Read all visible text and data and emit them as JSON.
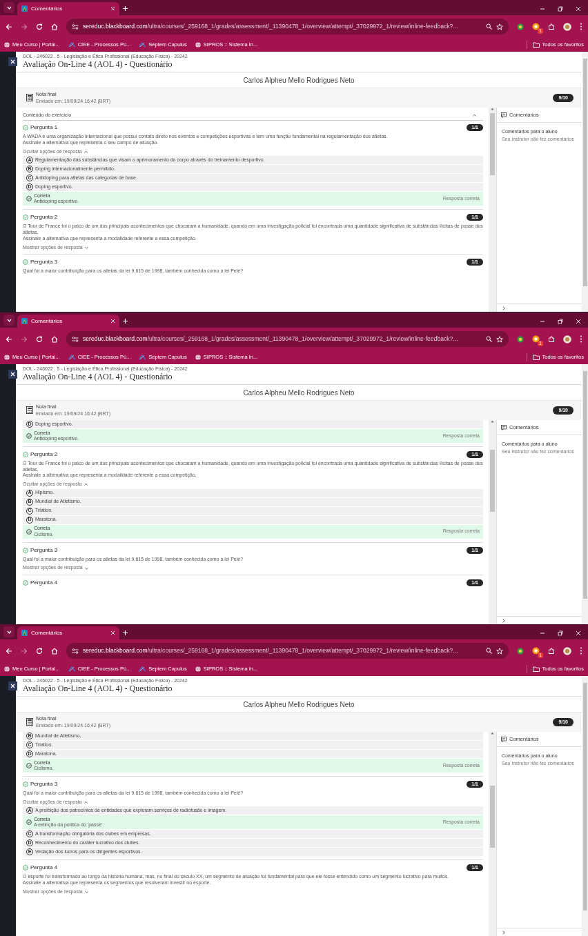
{
  "screens": [
    {
      "browser": {
        "tab_title": "Comentários",
        "url_host": "sereduc.blackboard.com",
        "url_path": "/ultra/courses/_259168_1/grades/assessment/_11390478_1/overview/attempt/_37029972_1/review/inline-feedback?...",
        "forward_disabled": true,
        "extension_badge": "1",
        "bookmarks": [
          {
            "label": "Meu Curso | Portal...",
            "kind": "globe"
          },
          {
            "label": "CIEE - Processos Pú...",
            "kind": "logo"
          },
          {
            "label": "Septem Capulus",
            "kind": "logo"
          },
          {
            "label": "SIPROS :: Sistema In...",
            "kind": "globe"
          }
        ],
        "all_bookmarks": "Todos os favoritos"
      },
      "breadcrumb": "DOL - 246022 . 5 - Legislação e Ética Profissional (Educação Física) - 20242",
      "title": "Avaliação On-Line 4 (AOL 4) - Questionário",
      "student": "Carlos Alpheu Mello Rodrigues Neto",
      "grade": {
        "label": "Nota final",
        "submitted": "Enviado em: 19/09/24 16:42 (BRT)",
        "score": "9/10"
      },
      "content": [
        {
          "kind": "section",
          "label": "Conteúdo do exercício",
          "expanded": true
        },
        {
          "kind": "question",
          "title": "Pergunta 1",
          "score": "1/1",
          "correct": true,
          "text": [
            "A WADA é uma organização internacional que possui contato direto nos eventos e competições esportivas e tem uma função fundamental na regulamentação dos atletas.",
            "Assinale a alternativa que representa o seu campo de atuação."
          ]
        },
        {
          "kind": "toggle",
          "label": "Ocultar opções de resposta",
          "expanded": true
        },
        {
          "kind": "option",
          "letter": "A",
          "text": "Regulamentação das substâncias que visam o aprimoramento do corpo através do treinamento desportivo."
        },
        {
          "kind": "option",
          "letter": "B",
          "text": "Doping internacionalmente permitido."
        },
        {
          "kind": "option",
          "letter": "C",
          "text": "Antidoping para atletas das categorias de base."
        },
        {
          "kind": "option",
          "letter": "D",
          "text": "Doping esportivo."
        },
        {
          "kind": "correct",
          "label": "Correta",
          "text": "Antidoping esportivo.",
          "note": "Resposta correta"
        },
        {
          "kind": "question",
          "title": "Pergunta 2",
          "score": "1/1",
          "correct": true,
          "text": [
            "O Tour de France foi o palco de um dos principais acontecimentos que chocaram a humanidade, quando em uma investigação policial foi encontrada uma quantidade significativa de substâncias ilícitas de posse dos atletas.",
            "Assinale a alternativa que representa a modalidade referente a essa competição."
          ]
        },
        {
          "kind": "toggle",
          "label": "Mostrar opções de resposta",
          "expanded": false
        },
        {
          "kind": "question",
          "title": "Pergunta 3",
          "score": "1/1",
          "correct": true,
          "text": [
            "Qual foi a maior contribuição para os atletas da lei 9.615 de 1998, também conhecida como a lei Pelé?"
          ]
        }
      ],
      "comments": {
        "title": "Comentários",
        "heading": "Comentários para o aluno",
        "text": "Seu instrutor não fez comentários"
      }
    },
    {
      "browser": {
        "tab_title": "Comentários",
        "url_host": "sereduc.blackboard.com",
        "url_path": "/ultra/courses/_259168_1/grades/assessment/_11390478_1/overview/attempt/_37029972_1/review/inline-feedback?...",
        "forward_disabled": true,
        "extension_badge": "1",
        "bookmarks": [
          {
            "label": "Meu Curso | Portal...",
            "kind": "globe"
          },
          {
            "label": "CIEE - Processos Pú...",
            "kind": "logo"
          },
          {
            "label": "Septem Capulus",
            "kind": "logo"
          },
          {
            "label": "SIPROS :: Sistema In...",
            "kind": "globe"
          }
        ],
        "all_bookmarks": "Todos os favoritos"
      },
      "breadcrumb": "DOL - 246022 . 5 - Legislação e Ética Profissional (Educação Física) - 20242",
      "title": "Avaliação On-Line 4 (AOL 4) - Questionário",
      "student": "Carlos Alpheu Mello Rodrigues Neto",
      "grade": {
        "label": "Nota final",
        "submitted": "Enviado em: 19/09/24 16:42 (BRT)",
        "score": "9/10"
      },
      "content": [
        {
          "kind": "option",
          "letter": "D",
          "text": "Doping esportivo."
        },
        {
          "kind": "correct",
          "label": "Correta",
          "text": "Antidoping esportivo.",
          "note": "Resposta correta"
        },
        {
          "kind": "question",
          "title": "Pergunta 2",
          "score": "1/1",
          "correct": true,
          "text": [
            "O Tour de France foi o palco de um dos principais acontecimentos que chocaram a humanidade, quando em uma investigação policial foi encontrada uma quantidade significativa de substâncias ilícitas de posse dos atletas.",
            "Assinale a alternativa que representa a modalidade referente a essa competição."
          ]
        },
        {
          "kind": "toggle",
          "label": "Ocultar opções de resposta",
          "expanded": true
        },
        {
          "kind": "option",
          "letter": "A",
          "text": "Hipismo."
        },
        {
          "kind": "option",
          "letter": "B",
          "text": "Mundial de Atletismo."
        },
        {
          "kind": "option",
          "letter": "C",
          "text": "Triatlon."
        },
        {
          "kind": "option",
          "letter": "D",
          "text": "Maratona."
        },
        {
          "kind": "correct",
          "label": "Correta",
          "text": "Ciclismo.",
          "note": "Resposta correta"
        },
        {
          "kind": "question",
          "title": "Pergunta 3",
          "score": "1/1",
          "correct": true,
          "text": [
            "Qual foi a maior contribuição para os atletas da lei 9.615 de 1998, também conhecida como a lei Pelé?"
          ]
        },
        {
          "kind": "toggle",
          "label": "Mostrar opções de resposta",
          "expanded": false
        },
        {
          "kind": "question",
          "title": "Pergunta 4",
          "score": "1/1",
          "correct": true
        }
      ],
      "comments": {
        "title": "Comentários",
        "heading": "Comentários para o aluno",
        "text": "Seu instrutor não fez comentários"
      }
    },
    {
      "browser": {
        "tab_title": "Comentários",
        "url_host": "sereduc.blackboard.com",
        "url_path": "/ultra/courses/_259168_1/grades/assessment/_11390478_1/overview/attempt/_37029972_1/review/inline-feedback?...",
        "forward_disabled": true,
        "extension_badge": "1",
        "bookmarks": [
          {
            "label": "Meu Curso | Portal...",
            "kind": "globe"
          },
          {
            "label": "CIEE - Processos Pú...",
            "kind": "logo"
          },
          {
            "label": "Septem Capulus",
            "kind": "logo"
          },
          {
            "label": "SIPROS :: Sistema In...",
            "kind": "globe"
          }
        ],
        "all_bookmarks": "Todos os favoritos"
      },
      "breadcrumb": "DOL - 246022 . 5 - Legislação e Ética Profissional (Educação Física) - 20242",
      "title": "Avaliação On-Line 4 (AOL 4) - Questionário",
      "student": "Carlos Alpheu Mello Rodrigues Neto",
      "grade": {
        "label": "Nota final",
        "submitted": "Enviado em: 19/09/24 16:42 (BRT)",
        "score": "9/10"
      },
      "content": [
        {
          "kind": "option",
          "letter": "B",
          "text": "Mundial de Atletismo."
        },
        {
          "kind": "option",
          "letter": "C",
          "text": "Triatlon."
        },
        {
          "kind": "option",
          "letter": "D",
          "text": "Maratona."
        },
        {
          "kind": "correct",
          "label": "Correta",
          "text": "Ciclismo.",
          "note": "Resposta correta"
        },
        {
          "kind": "question",
          "title": "Pergunta 3",
          "score": "1/1",
          "correct": true,
          "text": [
            "Qual foi a maior contribuição para os atletas da lei 9.615 de 1998, também conhecida como a lei Pelé?"
          ]
        },
        {
          "kind": "toggle",
          "label": "Ocultar opções de resposta",
          "expanded": true
        },
        {
          "kind": "option",
          "letter": "A",
          "text": "A proibição dos patrocínios de entidades que exploram serviços de radiofusão e imagem."
        },
        {
          "kind": "correct",
          "label": "Correta",
          "text": "A extinção da política do 'passe'.",
          "note": "Resposta correta"
        },
        {
          "kind": "option",
          "letter": "C",
          "text": "A transformação obrigatória dos clubes em empresas."
        },
        {
          "kind": "option",
          "letter": "D",
          "text": "Reconhecimento do caráter lucrativo dos clubes."
        },
        {
          "kind": "option",
          "letter": "E",
          "text": "Vedação dos lucros para os dirigentes esportivos."
        },
        {
          "kind": "question",
          "title": "Pergunta 4",
          "score": "1/1",
          "correct": true,
          "text": [
            "O esporte foi transformado ao longo da história humana, mas, no final do século XX, um segmento de atuação foi fundamental para que ele fosse entendido como um segmento lucrativo para muitos.",
            "Assinale a alternativa que representa os segmentos que resolveram investir no esporte."
          ]
        },
        {
          "kind": "toggle",
          "label": "Mostrar opções de resposta",
          "expanded": false
        }
      ],
      "comments": {
        "title": "Comentários",
        "heading": "Comentários para o aluno",
        "text": "Seu instrutor não fez comentários"
      }
    }
  ]
}
